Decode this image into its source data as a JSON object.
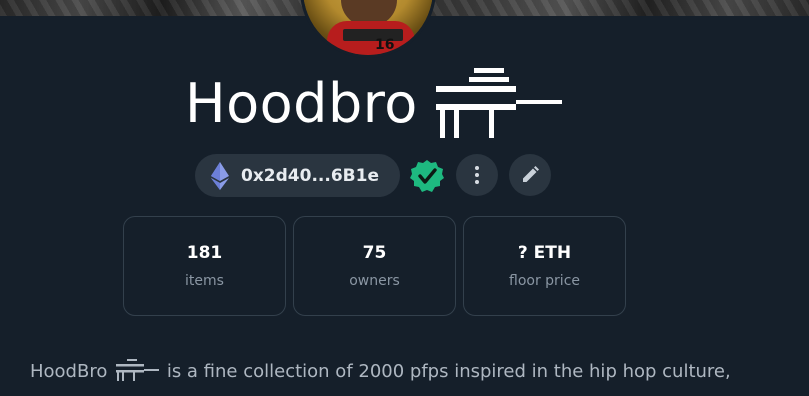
{
  "collection": {
    "name": "Hoodbro",
    "title_emblem": "gun-emblem-icon",
    "address": "0x2d40...6B1e",
    "verified": true
  },
  "stats": [
    {
      "value": "181",
      "label": "items"
    },
    {
      "value": "75",
      "label": "owners"
    },
    {
      "value": "? ETH",
      "label": "floor price"
    }
  ],
  "description": {
    "prefix": "HoodBro",
    "suffix": "is a fine collection of 2000 pfps inspired in the hip hop culture,"
  },
  "colors": {
    "background": "#151f2a",
    "pill": "#2a3540",
    "card_border": "#33404c",
    "verified_green": "#1eb980",
    "muted_text": "#8a96a3",
    "eth_purple": "#6c7fd8"
  }
}
